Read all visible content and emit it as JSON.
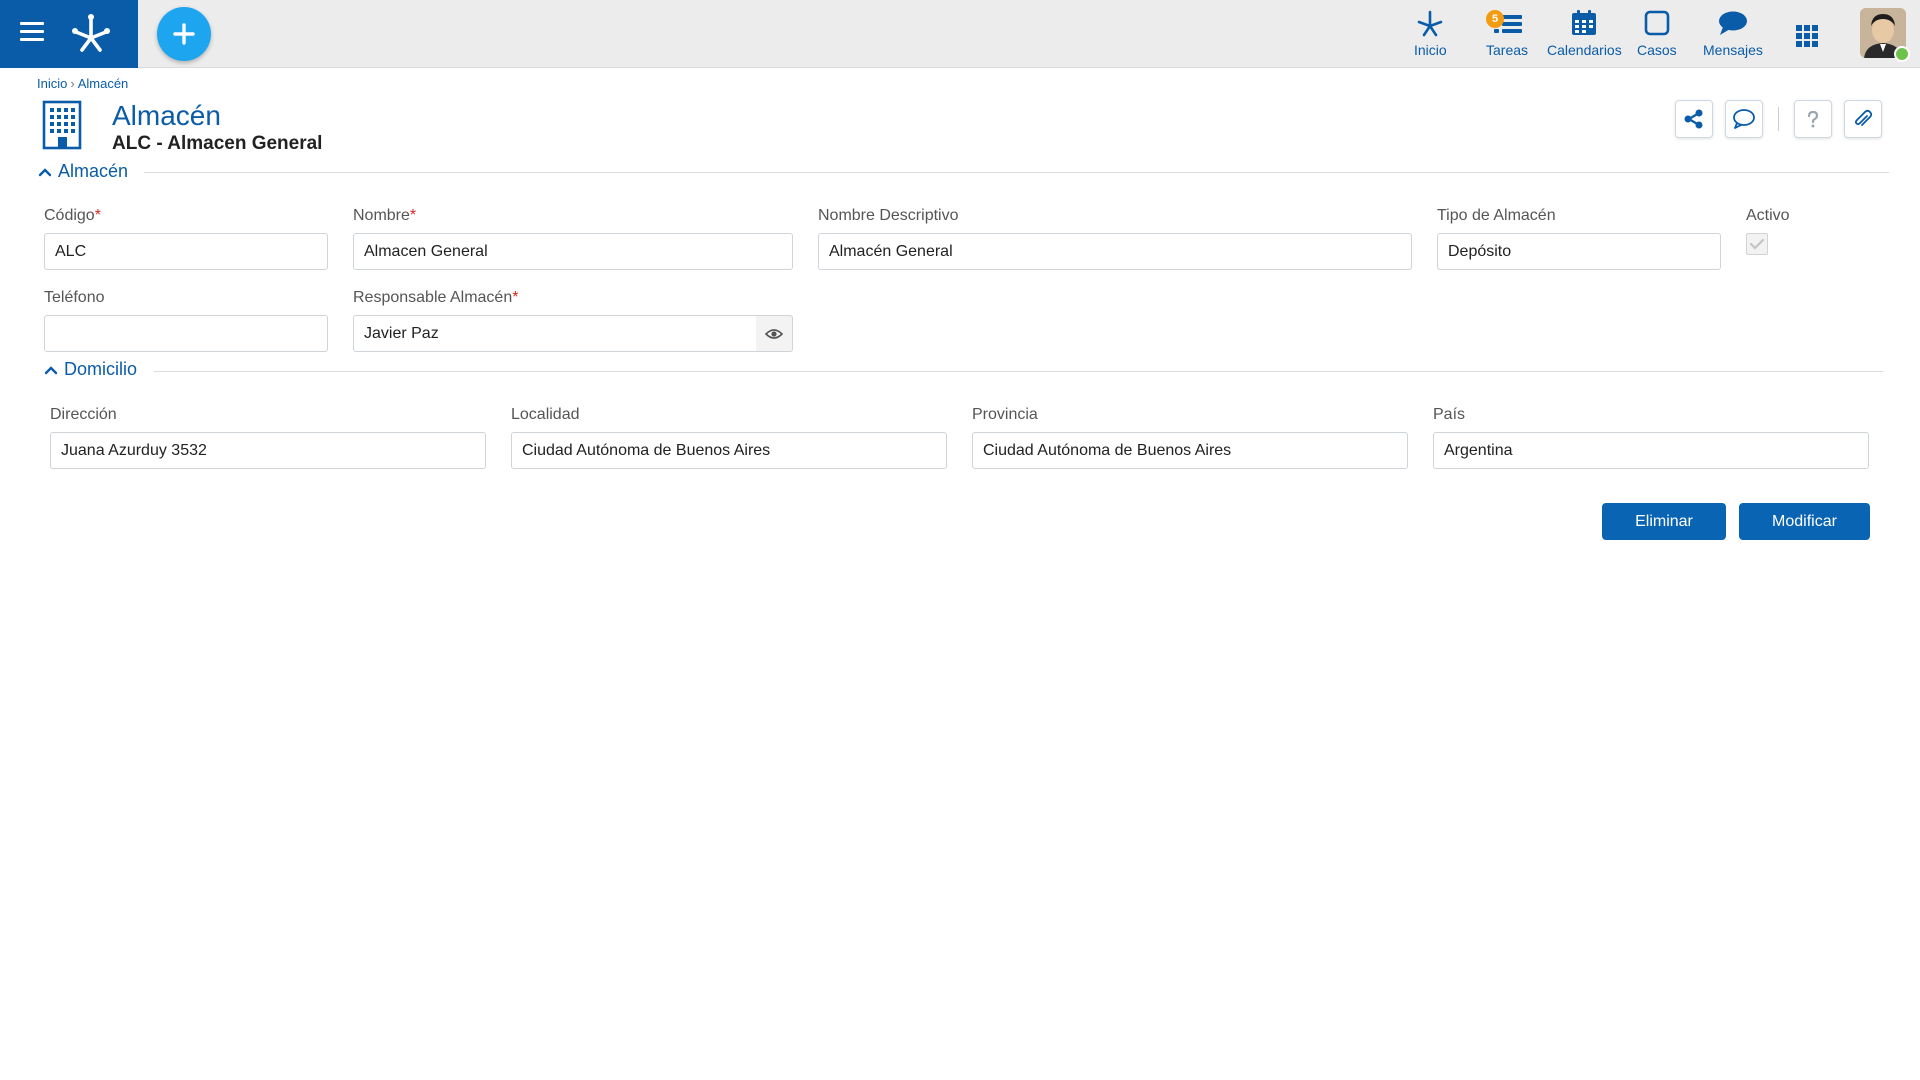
{
  "topbar": {
    "nav": [
      {
        "id": "inicio",
        "label": "Inicio",
        "icon": "home-network-icon"
      },
      {
        "id": "tareas",
        "label": "Tareas",
        "icon": "tasks-icon",
        "badge": "5"
      },
      {
        "id": "calendarios",
        "label": "Calendarios",
        "icon": "calendar-icon"
      },
      {
        "id": "casos",
        "label": "Casos",
        "icon": "case-icon"
      },
      {
        "id": "mensajes",
        "label": "Mensajes",
        "icon": "message-icon"
      }
    ],
    "brand_color": "#0a5ca8",
    "add_button_color": "#1ea5f0",
    "badge_color": "#f39c12",
    "online_color": "#6cc24a"
  },
  "breadcrumb": {
    "home": "Inicio",
    "separator": "›",
    "current": "Almacén"
  },
  "header": {
    "title": "Almacén",
    "subtitle": "ALC - Almacen General"
  },
  "sections": {
    "almacen": {
      "label": "Almacén",
      "fields": {
        "codigo": {
          "label": "Código",
          "required": true,
          "value": "ALC"
        },
        "nombre": {
          "label": "Nombre",
          "required": true,
          "value": "Almacen General"
        },
        "nombre_descriptivo": {
          "label": "Nombre Descriptivo",
          "value": "Almacén General"
        },
        "tipo_almacen": {
          "label": "Tipo de Almacén",
          "value": "Depósito"
        },
        "activo": {
          "label": "Activo",
          "checked": true
        },
        "telefono": {
          "label": "Teléfono",
          "value": ""
        },
        "responsable": {
          "label": "Responsable Almacén",
          "required": true,
          "value": "Javier Paz"
        }
      }
    },
    "domicilio": {
      "label": "Domicilio",
      "fields": {
        "direccion": {
          "label": "Dirección",
          "value": "Juana Azurduy 3532"
        },
        "localidad": {
          "label": "Localidad",
          "value": "Ciudad Autónoma de Buenos Aires"
        },
        "provincia": {
          "label": "Provincia",
          "value": "Ciudad Autónoma de Buenos Aires"
        },
        "pais": {
          "label": "País",
          "value": "Argentina"
        }
      }
    }
  },
  "required_marker": "*",
  "actions": {
    "eliminar": "Eliminar",
    "modificar": "Modificar"
  }
}
